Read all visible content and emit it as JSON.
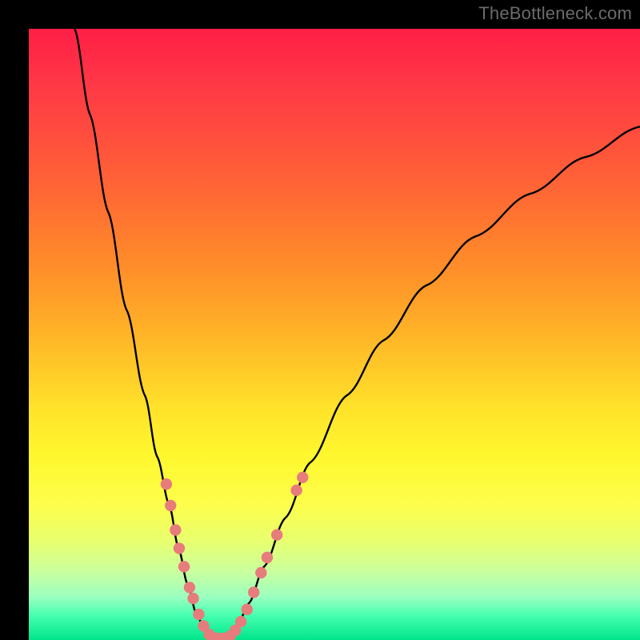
{
  "watermark": "TheBottleneck.com",
  "colors": {
    "curve_stroke": "#000000",
    "marker_fill": "#e77c7c",
    "marker_stroke": "#e77c7c"
  },
  "chart_data": {
    "type": "line",
    "title": "",
    "xlabel": "",
    "ylabel": "",
    "xlim": [
      0,
      100
    ],
    "ylim": [
      0,
      100
    ],
    "curve": {
      "left": [
        {
          "x": 7.5,
          "y": 100
        },
        {
          "x": 10,
          "y": 86
        },
        {
          "x": 13,
          "y": 70
        },
        {
          "x": 16,
          "y": 54
        },
        {
          "x": 19,
          "y": 40
        },
        {
          "x": 21,
          "y": 30
        },
        {
          "x": 23,
          "y": 22
        },
        {
          "x": 24.5,
          "y": 15
        },
        {
          "x": 26,
          "y": 9
        },
        {
          "x": 27.5,
          "y": 4
        },
        {
          "x": 29,
          "y": 1.2
        },
        {
          "x": 30.5,
          "y": 0.3
        }
      ],
      "right": [
        {
          "x": 32,
          "y": 0.3
        },
        {
          "x": 34,
          "y": 2
        },
        {
          "x": 36,
          "y": 6
        },
        {
          "x": 38.5,
          "y": 12
        },
        {
          "x": 42,
          "y": 20
        },
        {
          "x": 46,
          "y": 29
        },
        {
          "x": 52,
          "y": 40
        },
        {
          "x": 58,
          "y": 49
        },
        {
          "x": 65,
          "y": 58
        },
        {
          "x": 73,
          "y": 66
        },
        {
          "x": 82,
          "y": 73
        },
        {
          "x": 91,
          "y": 79
        },
        {
          "x": 100,
          "y": 84
        }
      ]
    },
    "markers": [
      {
        "x": 22.5,
        "y": 25.5
      },
      {
        "x": 23.2,
        "y": 22.0
      },
      {
        "x": 24.0,
        "y": 18.0
      },
      {
        "x": 24.6,
        "y": 15.0
      },
      {
        "x": 25.4,
        "y": 12.0
      },
      {
        "x": 26.3,
        "y": 8.6
      },
      {
        "x": 26.9,
        "y": 6.8
      },
      {
        "x": 27.8,
        "y": 4.2
      },
      {
        "x": 28.6,
        "y": 2.3
      },
      {
        "x": 29.5,
        "y": 0.9
      },
      {
        "x": 30.3,
        "y": 0.35
      },
      {
        "x": 31.2,
        "y": 0.25
      },
      {
        "x": 32.1,
        "y": 0.3
      },
      {
        "x": 33.0,
        "y": 0.7
      },
      {
        "x": 33.8,
        "y": 1.6
      },
      {
        "x": 34.7,
        "y": 3.0
      },
      {
        "x": 35.7,
        "y": 5.0
      },
      {
        "x": 36.8,
        "y": 7.8
      },
      {
        "x": 38.0,
        "y": 11.0
      },
      {
        "x": 39.0,
        "y": 13.5
      },
      {
        "x": 40.6,
        "y": 17.2
      },
      {
        "x": 43.8,
        "y": 24.5
      },
      {
        "x": 44.8,
        "y": 26.6
      }
    ]
  }
}
